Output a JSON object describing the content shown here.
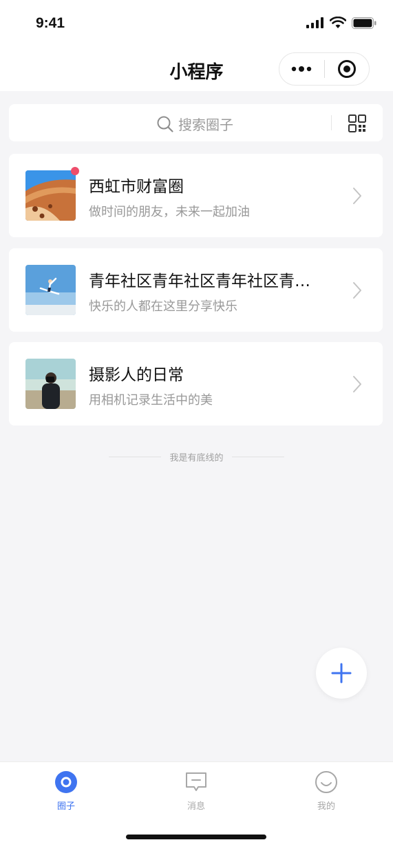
{
  "status_bar": {
    "time": "9:41"
  },
  "nav": {
    "title": "小程序"
  },
  "search": {
    "placeholder": "搜索圈子"
  },
  "circles": [
    {
      "title": "西虹市财富圈",
      "subtitle": "做时间的朋友，未来一起加油",
      "has_badge": true
    },
    {
      "title": "青年社区青年社区青年社区青…",
      "subtitle": "快乐的人都在这里分享快乐",
      "has_badge": false
    },
    {
      "title": "摄影人的日常",
      "subtitle": "用相机记录生活中的美",
      "has_badge": false
    }
  ],
  "list_end_text": "我是有底线的",
  "tabbar": {
    "items": [
      {
        "label": "圈子",
        "active": true
      },
      {
        "label": "消息",
        "active": false
      },
      {
        "label": "我的",
        "active": false
      }
    ]
  },
  "colors": {
    "accent": "#3f74f0",
    "badge": "#ee4d6b",
    "background": "#f5f5f7"
  }
}
